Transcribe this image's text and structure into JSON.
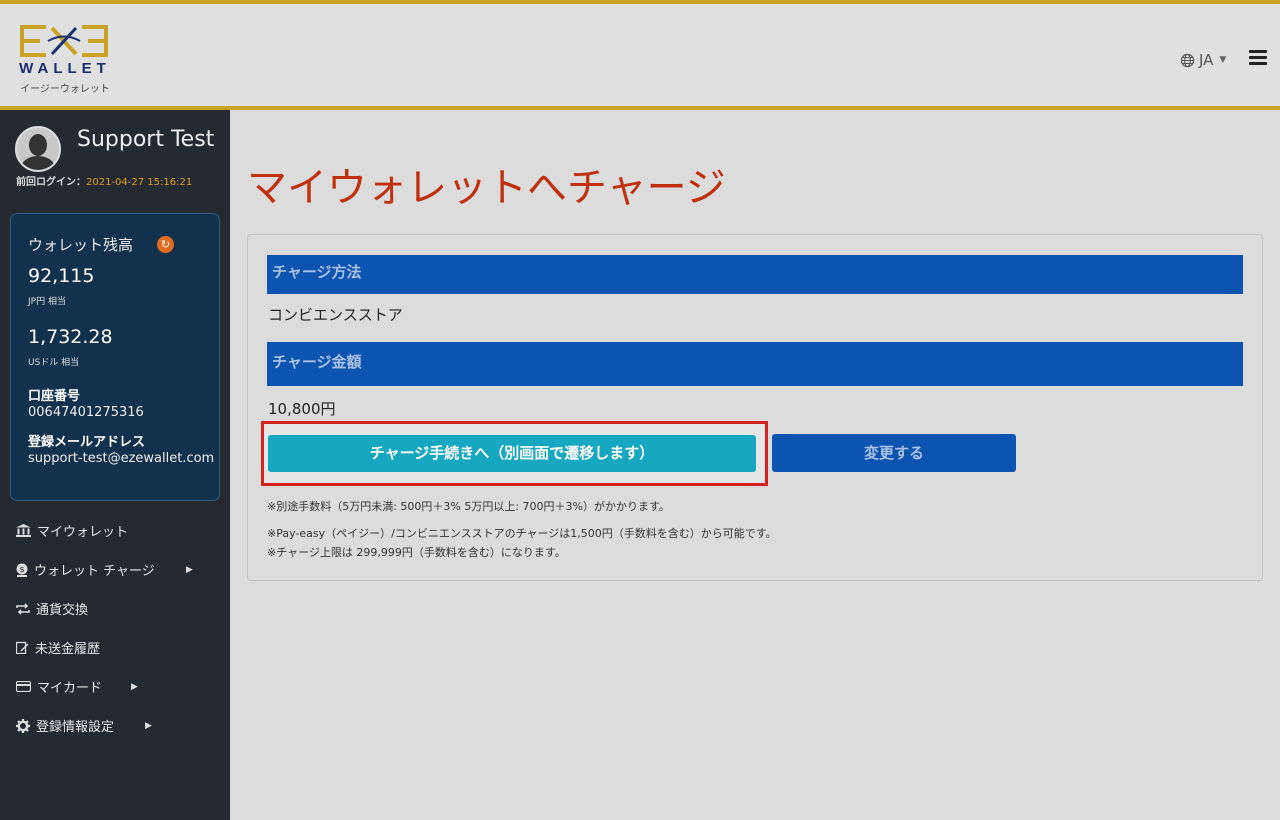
{
  "header": {
    "logo_word": "WALLET",
    "logo_kana": "イージーウォレット",
    "language": "JA",
    "colors": {
      "gold": "#c9a227",
      "navy": "#1c2f6b"
    }
  },
  "sidebar": {
    "user_name": "Support Test",
    "last_login_label": "前回ログイン：",
    "last_login_time": "2021-04-27 15:16:21",
    "wallet": {
      "title": "ウォレット残高",
      "jpy_amount": "92,115",
      "jpy_label": "JP円 相当",
      "usd_amount": "1,732.28",
      "usd_label": "USドル 相当",
      "account_label": "口座番号",
      "account_number": "00647401275316",
      "email_label": "登録メールアドレス",
      "email": "support-test@ezewallet.com"
    },
    "menu": [
      {
        "label": "マイウォレット",
        "icon": "bank-icon",
        "has_submenu": false
      },
      {
        "label": "ウォレット チャージ",
        "icon": "coin-icon",
        "has_submenu": true
      },
      {
        "label": "通貨交換",
        "icon": "exchange-icon",
        "has_submenu": false
      },
      {
        "label": "未送金履歴",
        "icon": "edit-icon",
        "has_submenu": false
      },
      {
        "label": "マイカード",
        "icon": "credit-card-icon",
        "has_submenu": true
      },
      {
        "label": "登録情報設定",
        "icon": "gear-icon",
        "has_submenu": true
      }
    ]
  },
  "main": {
    "title": "マイウォレットへチャージ",
    "method_header": "チャージ方法",
    "method_value": "コンビエンスストア",
    "amount_header": "チャージ金額",
    "amount_value": "10,800円",
    "proceed_button": "チャージ手続きへ（別画面で遷移します）",
    "change_button": "変更する",
    "notes": [
      "※別途手数料（5万円未満: 500円＋3% 5万円以上: 700円＋3%）がかかります。",
      "※Pay-easy（ペイジー）/コンビニエンスストアのチャージは1,500円（手数料を含む）から可能です。",
      "※チャージ上限は 299,999円（手数料を含む）になります。"
    ],
    "colors": {
      "title": "#c0300f",
      "section": "#0d54b0",
      "proceed": "#18a7c1",
      "highlight": "#d3231e"
    }
  }
}
